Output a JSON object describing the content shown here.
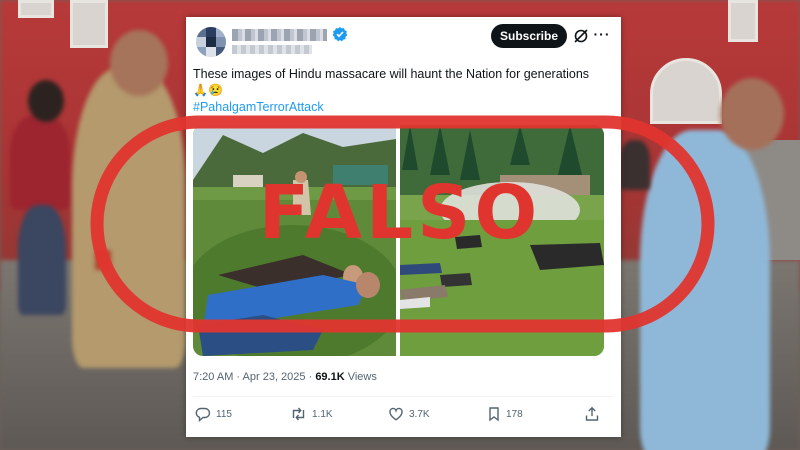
{
  "tweet": {
    "subscribe_label": "Subscribe",
    "more_label": "···",
    "text": "These images of Hindu massacare will haunt the Nation for generations",
    "emoji": "🙏😢",
    "hashtag": "#PahalgamTerrorAttack",
    "time": "7:20 AM",
    "date_sep": " · ",
    "date": "Apr 23, 2025",
    "views_count": "69.1K",
    "views_label": " Views",
    "replies": "115",
    "reposts": "1.1K",
    "likes": "3.7K",
    "bookmarks": "178"
  },
  "stamp": {
    "text": "FALSO",
    "color": "#e0352f"
  },
  "colors": {
    "link": "#1d9bf0",
    "text": "#0f1419",
    "muted": "#536471"
  },
  "icons": [
    "verified-icon",
    "grok-icon",
    "more-icon",
    "reply-icon",
    "repost-icon",
    "like-icon",
    "bookmark-icon",
    "share-icon"
  ]
}
